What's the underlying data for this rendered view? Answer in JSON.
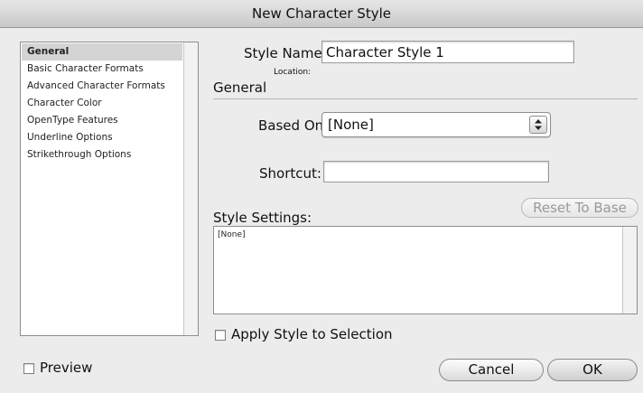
{
  "window": {
    "title": "New Character Style"
  },
  "sidebar": {
    "items": [
      {
        "label": "General",
        "selected": true
      },
      {
        "label": "Basic Character Formats"
      },
      {
        "label": "Advanced Character Formats"
      },
      {
        "label": "Character Color"
      },
      {
        "label": "OpenType Features"
      },
      {
        "label": "Underline Options"
      },
      {
        "label": "Strikethrough Options"
      }
    ]
  },
  "form": {
    "style_name_label": "Style Name:",
    "style_name_value": "Character Style 1",
    "location_label": "Location:",
    "section_title": "General",
    "based_on_label": "Based On:",
    "based_on_value": "[None]",
    "shortcut_label": "Shortcut:",
    "shortcut_value": "",
    "reset_button": "Reset To Base",
    "style_settings_label": "Style Settings:",
    "style_settings_text": "[None]",
    "apply_style_label": "Apply Style to Selection",
    "apply_style_checked": false
  },
  "footer": {
    "preview_label": "Preview",
    "preview_checked": false,
    "cancel_button": "Cancel",
    "ok_button": "OK"
  },
  "colors": {
    "window_bg": "#ececec",
    "selected_row": "#d4d4d4",
    "disabled_text": "#9a9a9a"
  }
}
